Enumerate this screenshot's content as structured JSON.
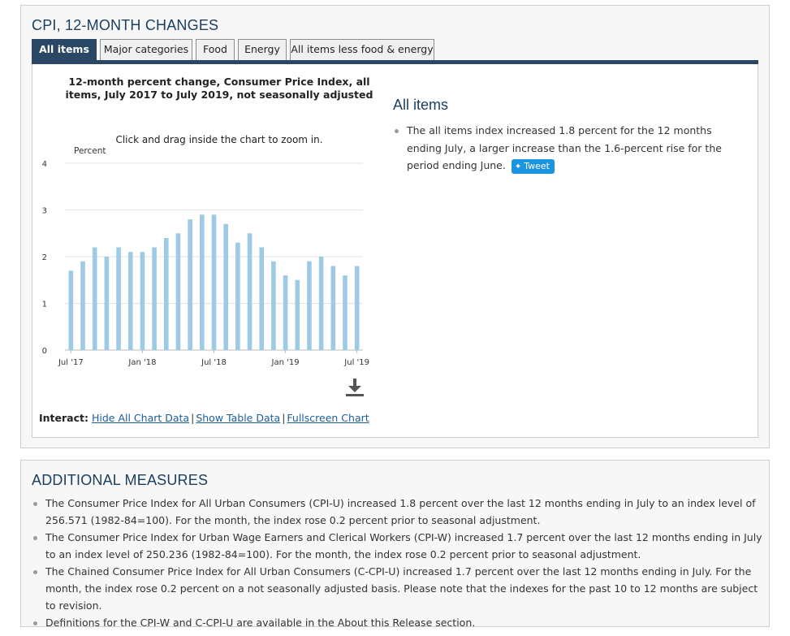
{
  "cpi_panel": {
    "title": "CPI, 12-MONTH CHANGES",
    "tabs": [
      "All items",
      "Major categories",
      "Food",
      "Energy",
      "All items less food & energy"
    ],
    "chart_hint": "Click and drag inside the chart to zoom in.",
    "interact": {
      "label": "Interact:",
      "links": [
        "Hide All Chart Data",
        "Show Table Data",
        "Fullscreen Chart"
      ]
    },
    "summary": {
      "heading": "All items",
      "text": "The all items index increased 1.8 percent for the 12 months ending July, a larger increase than the 1.6-percent rise for the period ending June.",
      "tweet_label": "Tweet"
    },
    "icons": [
      "download-icon",
      "twitter-bird-icon"
    ]
  },
  "chart_data": {
    "type": "bar",
    "title": "12-month percent change, Consumer Price Index, all items, July 2017 to July 2019, not seasonally adjusted",
    "ylabel": "Percent",
    "ylim": [
      0,
      4
    ],
    "yticks": [
      0,
      1,
      2,
      3,
      4
    ],
    "xtick_labels": [
      "Jul '17",
      "Jan '18",
      "Jul '18",
      "Jan '19",
      "Jul '19"
    ],
    "xtick_indices": [
      0,
      6,
      12,
      18,
      24
    ],
    "categories": [
      "Jul 2017",
      "Aug 2017",
      "Sep 2017",
      "Oct 2017",
      "Nov 2017",
      "Dec 2017",
      "Jan 2018",
      "Feb 2018",
      "Mar 2018",
      "Apr 2018",
      "May 2018",
      "Jun 2018",
      "Jul 2018",
      "Aug 2018",
      "Sep 2018",
      "Oct 2018",
      "Nov 2018",
      "Dec 2018",
      "Jan 2019",
      "Feb 2019",
      "Mar 2019",
      "Apr 2019",
      "May 2019",
      "Jun 2019",
      "Jul 2019"
    ],
    "values": [
      1.7,
      1.9,
      2.2,
      2.0,
      2.2,
      2.1,
      2.1,
      2.2,
      2.4,
      2.5,
      2.8,
      2.9,
      2.9,
      2.7,
      2.3,
      2.5,
      2.2,
      1.9,
      1.6,
      1.5,
      1.9,
      2.0,
      1.8,
      1.6,
      1.8
    ],
    "bar_color": "#9ccbe3",
    "grid": true
  },
  "additional": {
    "title": "ADDITIONAL MEASURES",
    "items": [
      "The Consumer Price Index for All Urban Consumers (CPI-U) increased 1.8 percent over the last 12 months ending in July to an index level of 256.571 (1982-84=100). For the month, the index rose 0.2 percent prior to seasonal adjustment.",
      "The Consumer Price Index for Urban Wage Earners and Clerical Workers (CPI-W) increased 1.7 percent over the last 12 months ending in July to an index level of 250.236 (1982-84=100). For the month, the index rose 0.2 percent prior to seasonal adjustment.",
      "The Chained Consumer Price Index for All Urban Consumers (C-CPI-U) increased 1.7 percent over the last 12 months ending in July. For the month, the index rose 0.2 percent on a not seasonally adjusted basis. Please note that the indexes for the past 10 to 12 months are subject to revision.",
      "Definitions for the CPI-W and C-CPI-U are available in the About this Release section."
    ]
  },
  "colors": {
    "heading": "#1c3e60",
    "tab_active": "#2a4765",
    "link": "#1a5e9c",
    "bar": "#9ccbe3",
    "tweet": "#1b95e0"
  }
}
